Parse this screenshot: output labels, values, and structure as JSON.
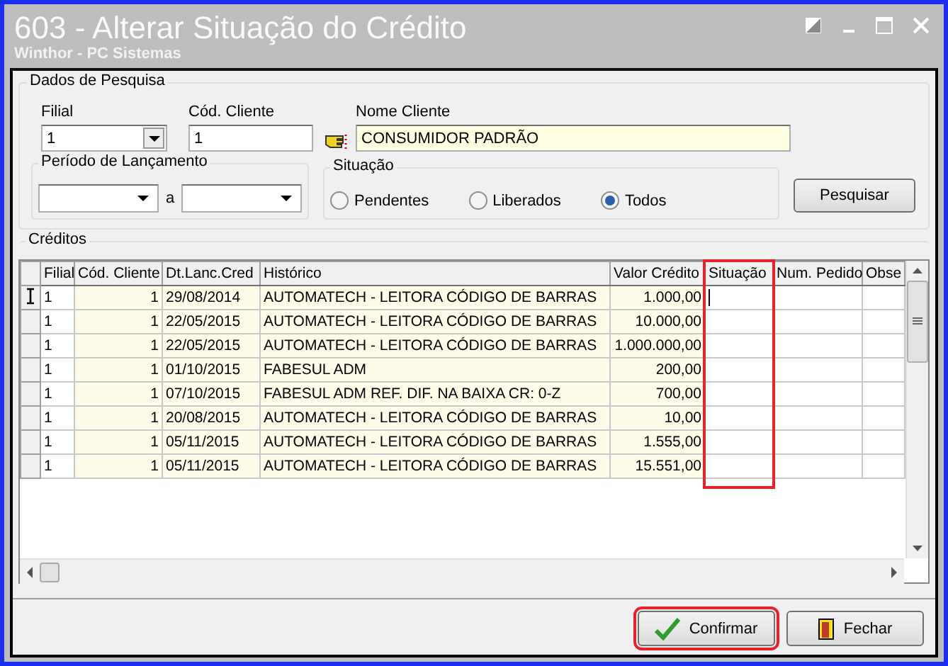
{
  "window": {
    "title": "603 - Alterar Situação do Crédito",
    "subtitle": "Winthor - PC Sistemas"
  },
  "search_panel": {
    "title": "Dados de Pesquisa",
    "filial": {
      "label": "Filial",
      "value": "1"
    },
    "client_code": {
      "label": "Cód. Cliente",
      "value": "1"
    },
    "client_name": {
      "label": "Nome Cliente",
      "value": "CONSUMIDOR PADRÃO"
    },
    "period": {
      "title": "Período de Lançamento",
      "separator": "a"
    },
    "status": {
      "title": "Situação",
      "options": [
        {
          "label": "Pendentes",
          "selected": false
        },
        {
          "label": "Liberados",
          "selected": false
        },
        {
          "label": "Todos",
          "selected": true
        }
      ]
    },
    "search_button": "Pesquisar"
  },
  "credits": {
    "title": "Créditos",
    "columns": [
      {
        "label": "Filial",
        "kind": "text",
        "shaded": false,
        "highlighted": false
      },
      {
        "label": "Cód. Cliente",
        "kind": "number",
        "shaded": true,
        "highlighted": false
      },
      {
        "label": "Dt.Lanc.Cred",
        "kind": "text",
        "shaded": true,
        "highlighted": false
      },
      {
        "label": "Histórico",
        "kind": "text",
        "shaded": true,
        "highlighted": false
      },
      {
        "label": "Valor Crédito",
        "kind": "number",
        "shaded": true,
        "highlighted": false
      },
      {
        "label": "Situação",
        "kind": "text",
        "shaded": false,
        "highlighted": true
      },
      {
        "label": "Num. Pedido",
        "kind": "text",
        "shaded": false,
        "highlighted": false
      },
      {
        "label": "Obse",
        "kind": "text",
        "shaded": false,
        "highlighted": false
      }
    ],
    "rows": [
      {
        "current": true,
        "cells": [
          "1",
          "1",
          "29/08/2014",
          "AUTOMATECH - LEITORA CÓDIGO DE BARRAS",
          "1.000,00"
        ]
      },
      {
        "current": false,
        "cells": [
          "1",
          "1",
          "22/05/2015",
          "AUTOMATECH - LEITORA CÓDIGO DE BARRAS",
          "10.000,00"
        ]
      },
      {
        "current": false,
        "cells": [
          "1",
          "1",
          "22/05/2015",
          "AUTOMATECH - LEITORA CÓDIGO DE BARRAS",
          "1.000.000,00"
        ]
      },
      {
        "current": false,
        "cells": [
          "1",
          "1",
          "01/10/2015",
          "FABESUL ADM",
          "200,00"
        ]
      },
      {
        "current": false,
        "cells": [
          "1",
          "1",
          "07/10/2015",
          "FABESUL ADM REF. DIF. NA BAIXA CR: 0-Z",
          "700,00"
        ]
      },
      {
        "current": false,
        "cells": [
          "1",
          "1",
          "20/08/2015",
          "AUTOMATECH - LEITORA CÓDIGO DE BARRAS",
          "10,00"
        ]
      },
      {
        "current": false,
        "cells": [
          "1",
          "1",
          "05/11/2015",
          "AUTOMATECH - LEITORA CÓDIGO DE BARRAS",
          "1.555,00"
        ]
      },
      {
        "current": false,
        "cells": [
          "1",
          "1",
          "05/11/2015",
          "AUTOMATECH - LEITORA CÓDIGO DE BARRAS",
          "15.551,00"
        ]
      }
    ]
  },
  "buttons": [
    {
      "label": "Confirmar",
      "kind": "confirm",
      "highlighted": true
    },
    {
      "label": "Fechar",
      "kind": "close",
      "highlighted": false
    }
  ]
}
